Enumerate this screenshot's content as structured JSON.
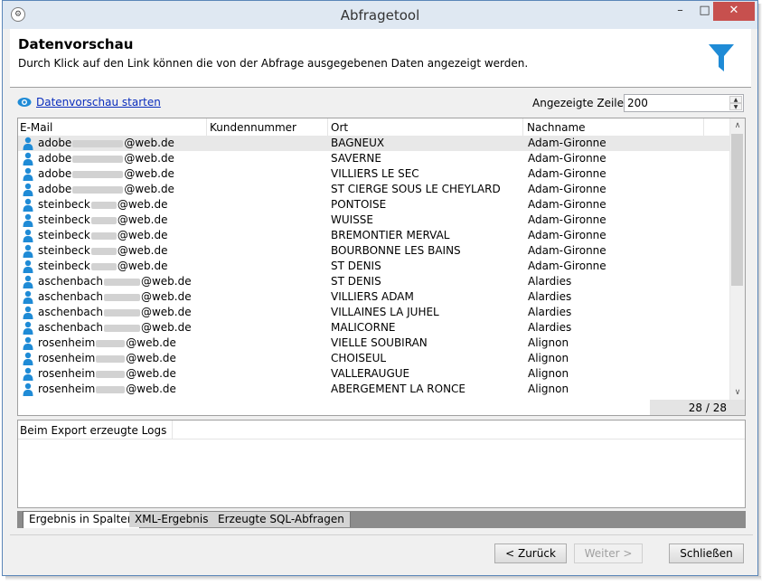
{
  "window": {
    "title": "Abfragetool",
    "min_glyph": "–",
    "max_glyph": "□",
    "close_glyph": "✕"
  },
  "header": {
    "title": "Datenvorschau",
    "description": "Durch Klick auf den Link können die von der Abfrage ausgegebenen Daten angezeigt werden.",
    "icon": "funnel-icon",
    "icon_color": "#1f8bd6"
  },
  "toolbar": {
    "preview_link": "Datenvorschau starten",
    "rows_label": "Angezeigte Zeilen:",
    "rows_value": "200"
  },
  "grid": {
    "columns": [
      "E-Mail",
      "Kundennummer",
      "Ort",
      "Nachname"
    ],
    "rows": [
      {
        "mail_prefix": "adobe",
        "mail_suffix": "@web.de",
        "blur": 56,
        "ort": "BAGNEUX",
        "name": "Adam-Gironne"
      },
      {
        "mail_prefix": "adobe",
        "mail_suffix": "@web.de",
        "blur": 56,
        "ort": "SAVERNE",
        "name": "Adam-Gironne"
      },
      {
        "mail_prefix": "adobe",
        "mail_suffix": "@web.de",
        "blur": 56,
        "ort": "VILLIERS LE SEC",
        "name": "Adam-Gironne"
      },
      {
        "mail_prefix": "adobe",
        "mail_suffix": "@web.de",
        "blur": 56,
        "ort": "ST CIERGE SOUS LE CHEYLARD",
        "name": "Adam-Gironne"
      },
      {
        "mail_prefix": "steinbeck",
        "mail_suffix": "@web.de",
        "blur": 28,
        "ort": "PONTOISE",
        "name": "Adam-Gironne"
      },
      {
        "mail_prefix": "steinbeck",
        "mail_suffix": "@web.de",
        "blur": 28,
        "ort": "WUISSE",
        "name": "Adam-Gironne"
      },
      {
        "mail_prefix": "steinbeck",
        "mail_suffix": "@web.de",
        "blur": 28,
        "ort": "BREMONTIER MERVAL",
        "name": "Adam-Gironne"
      },
      {
        "mail_prefix": "steinbeck",
        "mail_suffix": "@web.de",
        "blur": 28,
        "ort": "BOURBONNE LES BAINS",
        "name": "Adam-Gironne"
      },
      {
        "mail_prefix": "steinbeck",
        "mail_suffix": "@web.de",
        "blur": 28,
        "ort": "ST DENIS",
        "name": "Adam-Gironne"
      },
      {
        "mail_prefix": "aschenbach",
        "mail_suffix": "@web.de",
        "blur": 40,
        "ort": "ST DENIS",
        "name": "Alardies"
      },
      {
        "mail_prefix": "aschenbach",
        "mail_suffix": "@web.de",
        "blur": 40,
        "ort": "VILLIERS ADAM",
        "name": "Alardies"
      },
      {
        "mail_prefix": "aschenbach",
        "mail_suffix": "@web.de",
        "blur": 40,
        "ort": "VILLAINES LA JUHEL",
        "name": "Alardies"
      },
      {
        "mail_prefix": "aschenbach",
        "mail_suffix": "@web.de",
        "blur": 40,
        "ort": "MALICORNE",
        "name": "Alardies"
      },
      {
        "mail_prefix": "rosenheim",
        "mail_suffix": "@web.de",
        "blur": 32,
        "ort": "VIELLE SOUBIRAN",
        "name": "Alignon"
      },
      {
        "mail_prefix": "rosenheim",
        "mail_suffix": "@web.de",
        "blur": 32,
        "ort": "CHOISEUL",
        "name": "Alignon"
      },
      {
        "mail_prefix": "rosenheim",
        "mail_suffix": "@web.de",
        "blur": 32,
        "ort": "VALLERAUGUE",
        "name": "Alignon"
      },
      {
        "mail_prefix": "rosenheim",
        "mail_suffix": "@web.de",
        "blur": 32,
        "ort": "ABERGEMENT LA RONCE",
        "name": "Alignon"
      }
    ],
    "count": "28 / 28",
    "scroll_up": "∧",
    "scroll_down": "∨"
  },
  "logs": {
    "header": "Beim Export erzeugte Logs"
  },
  "tabs": [
    {
      "label": "Ergebnis in Spalten",
      "active": true
    },
    {
      "label": "XML-Ergebnis",
      "active": false
    },
    {
      "label": "Erzeugte SQL-Abfragen",
      "active": false
    }
  ],
  "buttons": {
    "back": "< Zurück",
    "next": "Weiter >",
    "close": "Schließen"
  },
  "colors": {
    "accent": "#1f8bd6",
    "link": "#0a2dbd",
    "close_button": "#c7504e"
  }
}
